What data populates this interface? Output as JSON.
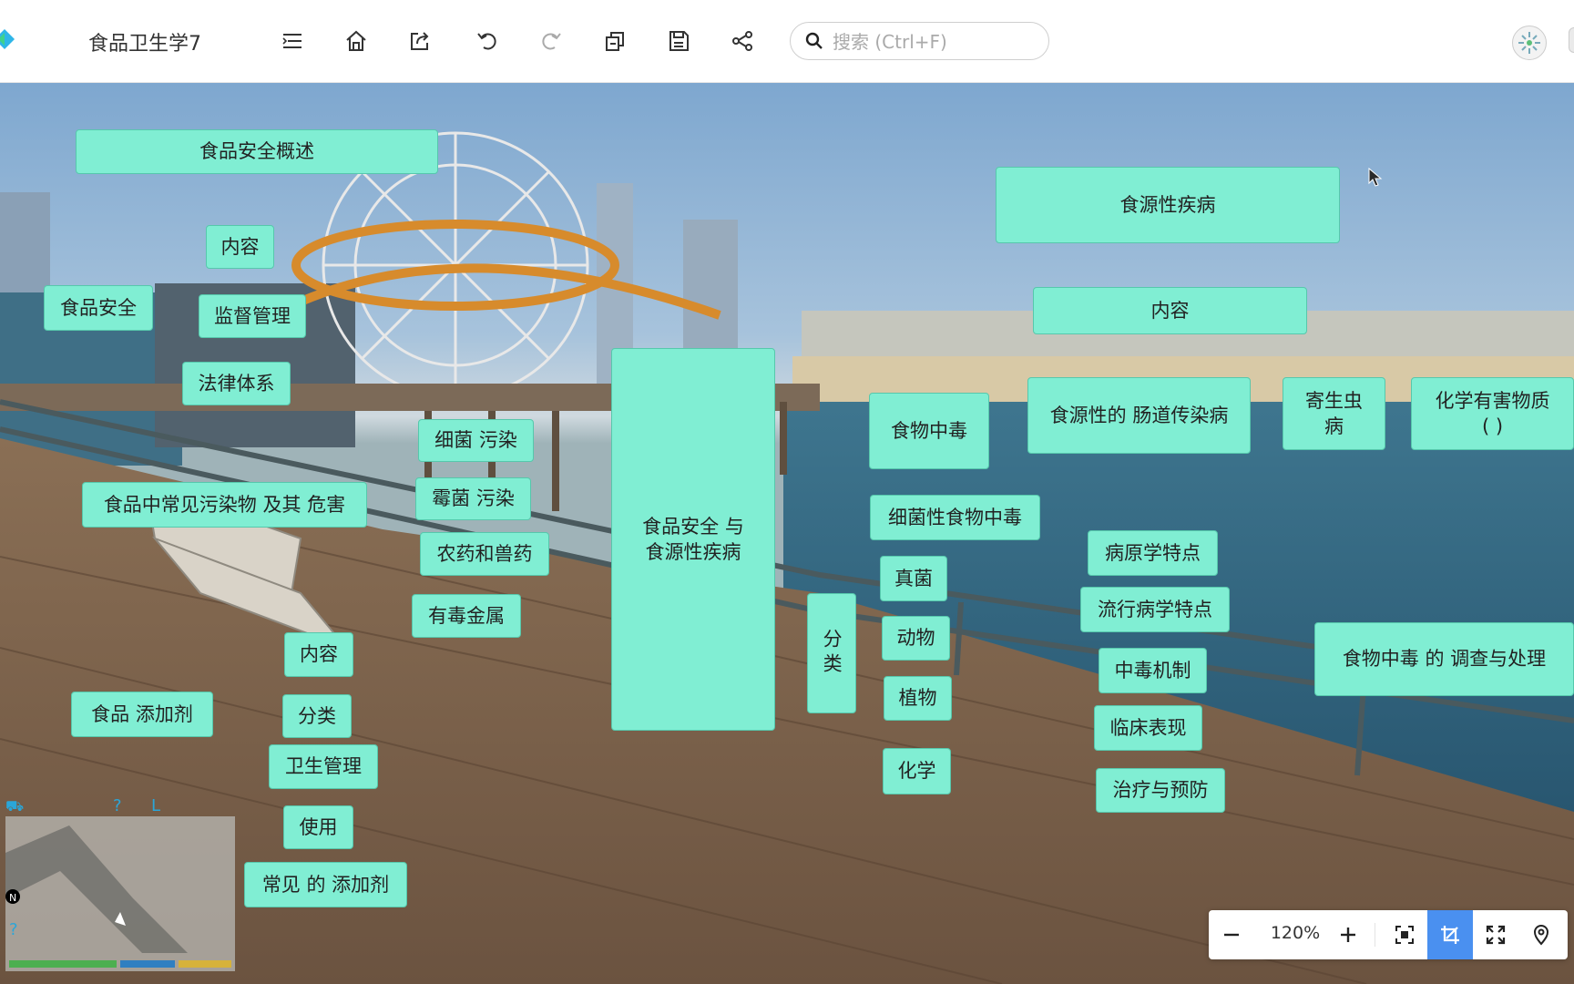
{
  "app": {
    "doc_title": "食品卫生学7"
  },
  "toolbar": {
    "buttons": [
      {
        "name": "outline-button",
        "icon": "outline-icon"
      },
      {
        "name": "home-button",
        "icon": "home-icon"
      },
      {
        "name": "export-button",
        "icon": "export-icon"
      },
      {
        "name": "undo-button",
        "icon": "undo-icon"
      },
      {
        "name": "redo-button",
        "icon": "redo-icon"
      },
      {
        "name": "copy-format-button",
        "icon": "copy-icon"
      },
      {
        "name": "save-button",
        "icon": "save-icon"
      },
      {
        "name": "share-button",
        "icon": "share-icon"
      }
    ],
    "search_placeholder": "搜索 (Ctrl+F)"
  },
  "nodes": {
    "food_safety_overview": "食品安全概述",
    "content_1": "内容",
    "food_safety": "食品安全",
    "supervision": "监督管理",
    "legal_system": "法律体系",
    "bacterial_contamination": "细菌 污染",
    "mold_contamination": "霉菌 污染",
    "common_contaminants": "食品中常见污染物 及其 危害",
    "pesticide_vet_drugs": "农药和兽药",
    "toxic_metals": "有毒金属",
    "content_2": "内容",
    "food_additives": "食品 添加剂",
    "classification_1": "分类",
    "hygiene_management": "卫生管理",
    "usage": "使用",
    "common_additives": "常见 的 添加剂",
    "central_line1": "食品安全 与",
    "central_line2": "食源性疾病",
    "classification_2": "分类",
    "foodborne_disease": "食源性疾病",
    "content_3": "内容",
    "food_poisoning": "食物中毒",
    "intestinal_infectious": "食源性的 肠道传染病",
    "parasitic_disease_line1": "寄生虫",
    "parasitic_disease_line2": "病",
    "chemical_hazards_line1": "化学有害物质",
    "chemical_hazards_line2": "( )",
    "bacterial_food_poisoning": "细菌性食物中毒",
    "fungi": "真菌",
    "animal": "动物",
    "plant": "植物",
    "chemical": "化学",
    "pathogen_features": "病原学特点",
    "epidemiology_features": "流行病学特点",
    "poisoning_mechanism": "中毒机制",
    "clinical_manifestation": "临床表现",
    "treatment_prevention": "治疗与预防",
    "investigation_handling": "食物中毒 的 调查与处理"
  },
  "zoombar": {
    "zoom_level": "120%"
  },
  "colors": {
    "node_fill": "#80eed3",
    "node_border": "#56c8ac",
    "active_button": "#4a90f0"
  }
}
